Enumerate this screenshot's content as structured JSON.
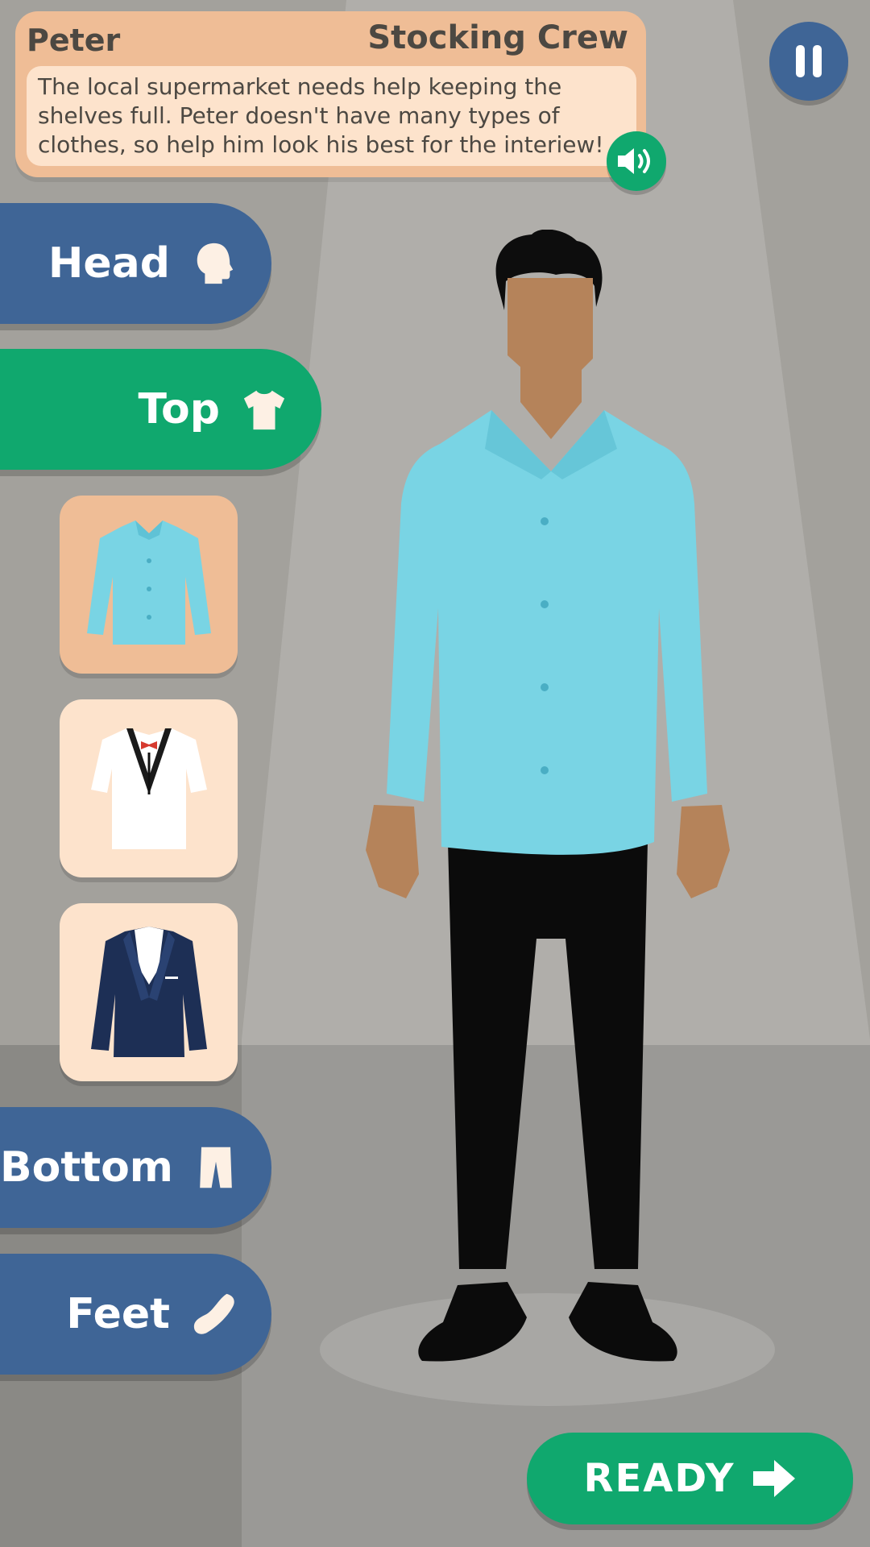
{
  "character": {
    "name": "Peter",
    "job": "Stocking Crew",
    "description": "The local supermarket needs help keeping the shelves full. Peter doesn't have many types of clothes, so help him look his best for the interiew!"
  },
  "buttons": {
    "audio_icon": "speaker-icon",
    "pause_icon": "pause-icon",
    "ready_label": "READY",
    "ready_icon": "arrow-right-icon"
  },
  "categories": [
    {
      "label": "Head",
      "icon": "head-icon",
      "selected": false
    },
    {
      "label": "Top",
      "icon": "shirt-icon",
      "selected": true
    },
    {
      "label": "Bottom",
      "icon": "pants-icon",
      "selected": false
    },
    {
      "label": "Feet",
      "icon": "shoe-icon",
      "selected": false
    }
  ],
  "top_items": [
    {
      "name": "light-blue-shirt",
      "selected": true
    },
    {
      "name": "tuxedo-t-shirt",
      "selected": false
    },
    {
      "name": "navy-blazer",
      "selected": false
    }
  ],
  "colors": {
    "blue": "#3f6596",
    "green": "#10a86e",
    "card": "#efbd96",
    "card_light": "#fde3cc",
    "shirt": "#79d4e4"
  }
}
